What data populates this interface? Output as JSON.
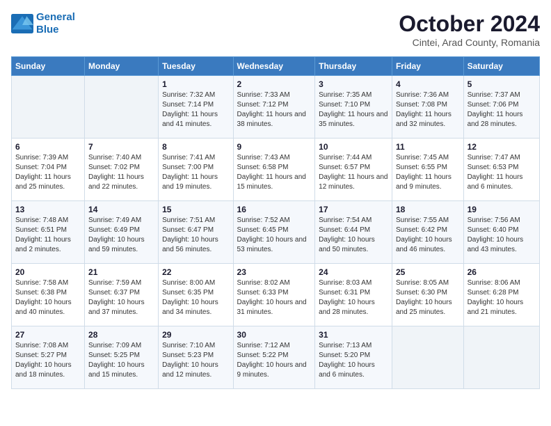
{
  "logo": {
    "line1": "General",
    "line2": "Blue"
  },
  "title": "October 2024",
  "subtitle": "Cintei, Arad County, Romania",
  "weekdays": [
    "Sunday",
    "Monday",
    "Tuesday",
    "Wednesday",
    "Thursday",
    "Friday",
    "Saturday"
  ],
  "weeks": [
    [
      null,
      null,
      {
        "day": 1,
        "sunrise": "7:32 AM",
        "sunset": "7:14 PM",
        "daylight": "11 hours and 41 minutes."
      },
      {
        "day": 2,
        "sunrise": "7:33 AM",
        "sunset": "7:12 PM",
        "daylight": "11 hours and 38 minutes."
      },
      {
        "day": 3,
        "sunrise": "7:35 AM",
        "sunset": "7:10 PM",
        "daylight": "11 hours and 35 minutes."
      },
      {
        "day": 4,
        "sunrise": "7:36 AM",
        "sunset": "7:08 PM",
        "daylight": "11 hours and 32 minutes."
      },
      {
        "day": 5,
        "sunrise": "7:37 AM",
        "sunset": "7:06 PM",
        "daylight": "11 hours and 28 minutes."
      }
    ],
    [
      {
        "day": 6,
        "sunrise": "7:39 AM",
        "sunset": "7:04 PM",
        "daylight": "11 hours and 25 minutes."
      },
      {
        "day": 7,
        "sunrise": "7:40 AM",
        "sunset": "7:02 PM",
        "daylight": "11 hours and 22 minutes."
      },
      {
        "day": 8,
        "sunrise": "7:41 AM",
        "sunset": "7:00 PM",
        "daylight": "11 hours and 19 minutes."
      },
      {
        "day": 9,
        "sunrise": "7:43 AM",
        "sunset": "6:58 PM",
        "daylight": "11 hours and 15 minutes."
      },
      {
        "day": 10,
        "sunrise": "7:44 AM",
        "sunset": "6:57 PM",
        "daylight": "11 hours and 12 minutes."
      },
      {
        "day": 11,
        "sunrise": "7:45 AM",
        "sunset": "6:55 PM",
        "daylight": "11 hours and 9 minutes."
      },
      {
        "day": 12,
        "sunrise": "7:47 AM",
        "sunset": "6:53 PM",
        "daylight": "11 hours and 6 minutes."
      }
    ],
    [
      {
        "day": 13,
        "sunrise": "7:48 AM",
        "sunset": "6:51 PM",
        "daylight": "11 hours and 2 minutes."
      },
      {
        "day": 14,
        "sunrise": "7:49 AM",
        "sunset": "6:49 PM",
        "daylight": "10 hours and 59 minutes."
      },
      {
        "day": 15,
        "sunrise": "7:51 AM",
        "sunset": "6:47 PM",
        "daylight": "10 hours and 56 minutes."
      },
      {
        "day": 16,
        "sunrise": "7:52 AM",
        "sunset": "6:45 PM",
        "daylight": "10 hours and 53 minutes."
      },
      {
        "day": 17,
        "sunrise": "7:54 AM",
        "sunset": "6:44 PM",
        "daylight": "10 hours and 50 minutes."
      },
      {
        "day": 18,
        "sunrise": "7:55 AM",
        "sunset": "6:42 PM",
        "daylight": "10 hours and 46 minutes."
      },
      {
        "day": 19,
        "sunrise": "7:56 AM",
        "sunset": "6:40 PM",
        "daylight": "10 hours and 43 minutes."
      }
    ],
    [
      {
        "day": 20,
        "sunrise": "7:58 AM",
        "sunset": "6:38 PM",
        "daylight": "10 hours and 40 minutes."
      },
      {
        "day": 21,
        "sunrise": "7:59 AM",
        "sunset": "6:37 PM",
        "daylight": "10 hours and 37 minutes."
      },
      {
        "day": 22,
        "sunrise": "8:00 AM",
        "sunset": "6:35 PM",
        "daylight": "10 hours and 34 minutes."
      },
      {
        "day": 23,
        "sunrise": "8:02 AM",
        "sunset": "6:33 PM",
        "daylight": "10 hours and 31 minutes."
      },
      {
        "day": 24,
        "sunrise": "8:03 AM",
        "sunset": "6:31 PM",
        "daylight": "10 hours and 28 minutes."
      },
      {
        "day": 25,
        "sunrise": "8:05 AM",
        "sunset": "6:30 PM",
        "daylight": "10 hours and 25 minutes."
      },
      {
        "day": 26,
        "sunrise": "8:06 AM",
        "sunset": "6:28 PM",
        "daylight": "10 hours and 21 minutes."
      }
    ],
    [
      {
        "day": 27,
        "sunrise": "7:08 AM",
        "sunset": "5:27 PM",
        "daylight": "10 hours and 18 minutes."
      },
      {
        "day": 28,
        "sunrise": "7:09 AM",
        "sunset": "5:25 PM",
        "daylight": "10 hours and 15 minutes."
      },
      {
        "day": 29,
        "sunrise": "7:10 AM",
        "sunset": "5:23 PM",
        "daylight": "10 hours and 12 minutes."
      },
      {
        "day": 30,
        "sunrise": "7:12 AM",
        "sunset": "5:22 PM",
        "daylight": "10 hours and 9 minutes."
      },
      {
        "day": 31,
        "sunrise": "7:13 AM",
        "sunset": "5:20 PM",
        "daylight": "10 hours and 6 minutes."
      },
      null,
      null
    ]
  ]
}
